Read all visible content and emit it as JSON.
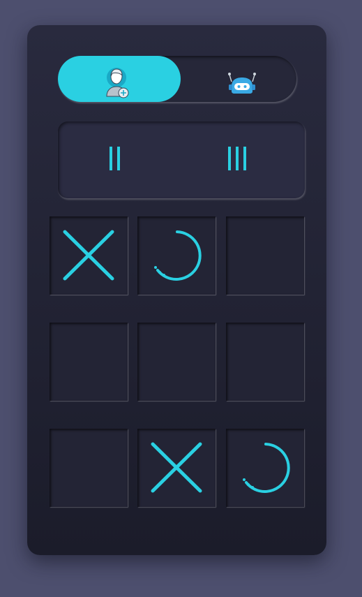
{
  "modes": [
    {
      "id": "human",
      "icon": "user-add-icon",
      "active": true
    },
    {
      "id": "bot",
      "icon": "robot-icon",
      "active": false
    }
  ],
  "scores": [
    {
      "player": "human",
      "tally": 2
    },
    {
      "player": "bot",
      "tally": 3
    }
  ],
  "board": [
    "X",
    "O",
    "",
    "",
    "",
    "",
    "",
    "X",
    "O"
  ],
  "colors": {
    "accent": "#2ad0e2",
    "card": "#24253a",
    "background": "#4d4f6e",
    "cell": "#232435"
  }
}
